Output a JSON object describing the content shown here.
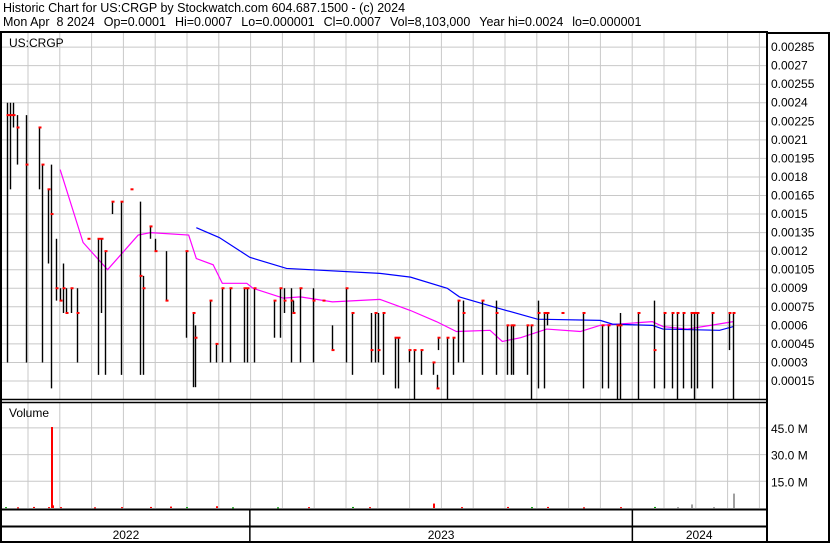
{
  "header": {
    "title": "Historic Chart for US:CRGP by Stockwatch.com 604.687.1500 - (c) 2024",
    "date": "Mon Apr  8 2024",
    "open": "Op=0.0001",
    "high": "Hi=0.0007",
    "low": "Lo=0.000001",
    "close": "Cl=0.0007",
    "volume": "Vol=8,103,000",
    "year_high": "Year hi=0.0024",
    "year_low": "lo=0.000001"
  },
  "colors": {
    "bar": "#000000",
    "close_tick": "#ff0000",
    "ma_short": "#ff00ff",
    "ma_long": "#0000ff",
    "grid": "#c8c8c8",
    "vol_up": "#00a000",
    "vol_down": "#ff0000",
    "vol_flat": "#a0a0a0"
  },
  "chart_data": [
    {
      "type": "ohlc",
      "title": "US:CRGP",
      "x_unit": "trading day index",
      "year_labels": [
        {
          "label": "2022",
          "start_day": 0
        },
        {
          "label": "2023",
          "start_day": 162
        },
        {
          "label": "2024",
          "start_day": 412
        }
      ],
      "ylim": [
        0,
        0.00297
      ],
      "y_ticks": [
        "0.00015",
        "0.0003",
        "0.00045",
        "0.0006",
        "0.00075",
        "0.0009",
        "0.00105",
        "0.0012",
        "0.00135",
        "0.0015",
        "0.00165",
        "0.0018",
        "0.00195",
        "0.0021",
        "0.00225",
        "0.0024",
        "0.00255",
        "0.0027",
        "0.00285"
      ],
      "bars_day_high_low_close": [
        [
          3,
          0.0024,
          0.0003,
          0.0023
        ],
        [
          5,
          0.0024,
          0.0017,
          0.0023
        ],
        [
          7,
          0.0024,
          0.0022,
          0.0023
        ],
        [
          10,
          0.0023,
          0.0019,
          0.0022
        ],
        [
          16,
          0.0023,
          0.0003,
          0.0019
        ],
        [
          24,
          0.0022,
          0.0017,
          0.0022
        ],
        [
          26,
          0.0019,
          0.0003,
          0.0019
        ],
        [
          30,
          0.0017,
          0.0011,
          0.0017
        ],
        [
          32,
          0.0019,
          9e-05,
          0.0015
        ],
        [
          35,
          0.0013,
          0.0008,
          0.0009
        ],
        [
          38,
          0.0009,
          0.0008,
          0.0008
        ],
        [
          40,
          0.0011,
          0.0007,
          0.0009
        ],
        [
          42,
          0.0009,
          0.0007,
          0.0007
        ],
        [
          45,
          0.0009,
          0.0007,
          0.0009
        ],
        [
          49,
          0.0009,
          0.0003,
          0.0007
        ],
        [
          56,
          0.0013,
          0.0013,
          0.0013
        ],
        [
          63,
          0.0013,
          0.0002,
          0.0013
        ],
        [
          65,
          0.0013,
          0.0007,
          0.0013
        ],
        [
          67,
          0.0012,
          0.0002,
          0.0012
        ],
        [
          72,
          0.0016,
          0.0015,
          0.0016
        ],
        [
          78,
          0.0016,
          0.0002,
          0.0016
        ],
        [
          84,
          0.0017,
          0.0017,
          0.0017
        ],
        [
          90,
          0.0016,
          0.0002,
          0.001
        ],
        [
          92,
          0.001,
          0.0002,
          0.0009
        ],
        [
          97,
          0.0014,
          0.0013,
          0.0014
        ],
        [
          100,
          0.0013,
          0.0012,
          0.0012
        ],
        [
          107,
          0.0012,
          0.0008,
          0.0008
        ],
        [
          120,
          0.0012,
          0.0005,
          0.0012
        ],
        [
          125,
          0.0007,
          0.0001,
          0.0007
        ],
        [
          126,
          0.0006,
          0.0001,
          0.0005
        ],
        [
          136,
          0.0008,
          0.0003,
          0.0008
        ],
        [
          140,
          0.00045,
          0.0003,
          0.00045
        ],
        [
          144,
          0.0009,
          0.0003,
          0.0009
        ],
        [
          149,
          0.0009,
          0.0003,
          0.0009
        ],
        [
          158,
          0.0009,
          0.0003,
          0.0009
        ],
        [
          160,
          0.0009,
          0.0003,
          0.0009
        ],
        [
          165,
          0.0009,
          0.0003,
          0.0009
        ],
        [
          178,
          0.0008,
          0.0005,
          0.0008
        ],
        [
          182,
          0.0009,
          0.0005,
          0.0009
        ],
        [
          184,
          0.0009,
          0.0007,
          0.0008
        ],
        [
          189,
          0.0009,
          0.0003,
          0.0008
        ],
        [
          190,
          0.0008,
          0.0007,
          0.0007
        ],
        [
          195,
          0.0009,
          0.0003,
          0.0009
        ],
        [
          203,
          0.0009,
          0.0003,
          0.0008
        ],
        [
          210,
          0.0008,
          0.0008,
          0.0008
        ],
        [
          216,
          0.0006,
          0.0004,
          0.0004
        ],
        [
          225,
          0.0009,
          0.0003,
          0.0009
        ],
        [
          229,
          0.0007,
          0.0002,
          0.0007
        ],
        [
          241,
          0.0007,
          0.0003,
          0.0004
        ],
        [
          244,
          0.0007,
          0.0003,
          0.0007
        ],
        [
          246,
          0.0007,
          0.0003,
          0.0004
        ],
        [
          249,
          0.0007,
          0.0002,
          0.0007
        ],
        [
          257,
          0.0005,
          9e-05,
          0.0005
        ],
        [
          259,
          0.0005,
          9e-05,
          0.0005
        ],
        [
          266,
          0.0004,
          0.0003,
          0.0004
        ],
        [
          269,
          0.0004,
          1e-06,
          0.0004
        ],
        [
          274,
          0.0004,
          0.0002,
          0.0004
        ],
        [
          282,
          0.0003,
          0.0002,
          0.0003
        ],
        [
          284,
          0.0002,
          9e-05,
          9e-05
        ],
        [
          285,
          0.0005,
          0.0004,
          0.0005
        ],
        [
          291,
          0.0005,
          1e-06,
          0.0005
        ],
        [
          295,
          0.0005,
          0.0002,
          0.0005
        ],
        [
          298,
          0.0008,
          0.0003,
          0.0008
        ],
        [
          301,
          0.0008,
          0.0003,
          0.0007
        ],
        [
          314,
          0.0008,
          0.0002,
          0.0008
        ],
        [
          323,
          0.0008,
          0.0002,
          0.0007
        ],
        [
          330,
          0.0006,
          0.0002,
          0.0006
        ],
        [
          333,
          0.0006,
          0.0002,
          0.0006
        ],
        [
          334,
          0.0006,
          0.0002,
          0.0006
        ],
        [
          343,
          0.0006,
          0.0002,
          0.0006
        ],
        [
          346,
          0.0006,
          1e-06,
          0.0006
        ],
        [
          350,
          0.0008,
          9e-05,
          0.0007
        ],
        [
          354,
          0.0007,
          9e-05,
          0.0007
        ],
        [
          356,
          0.0007,
          0.0006,
          0.0007
        ],
        [
          366,
          0.0007,
          0.0007,
          0.0007
        ],
        [
          380,
          0.0007,
          9e-05,
          0.0007
        ],
        [
          392,
          0.0006,
          9e-05,
          0.0006
        ],
        [
          396,
          0.0006,
          9e-05,
          0.0006
        ],
        [
          402,
          0.0006,
          1e-06,
          0.0006
        ],
        [
          404,
          0.0007,
          1e-06,
          0.0006
        ],
        [
          416,
          0.0007,
          1e-06,
          0.0007
        ],
        [
          426,
          0.0008,
          9e-05,
          0.0004
        ],
        [
          433,
          0.0007,
          9e-05,
          0.0007
        ],
        [
          438,
          0.0007,
          9e-05,
          0.0007
        ],
        [
          441,
          0.0007,
          1e-06,
          0.0007
        ],
        [
          445,
          0.0007,
          9e-05,
          0.0007
        ],
        [
          450,
          0.0007,
          9e-05,
          0.0007
        ],
        [
          452,
          0.0007,
          1e-06,
          0.0007
        ],
        [
          454,
          0.0007,
          9e-05,
          0.0007
        ],
        [
          464,
          0.0007,
          9e-05,
          0.0007
        ],
        [
          475,
          0.0007,
          0.0004,
          0.0007
        ],
        [
          478,
          0.0007,
          1e-06,
          0.0007
        ]
      ],
      "series": [
        {
          "name": "short moving average",
          "points_day_value": [
            [
              38,
              0.00186
            ],
            [
              53,
              0.00127
            ],
            [
              69,
              0.00105
            ],
            [
              79,
              0.00119
            ],
            [
              89,
              0.00133
            ],
            [
              97,
              0.00135
            ],
            [
              122,
              0.00133
            ],
            [
              127,
              0.00114
            ],
            [
              138,
              0.00109
            ],
            [
              144,
              0.00094
            ],
            [
              160,
              0.00094
            ],
            [
              164,
              0.0009
            ],
            [
              184,
              0.00082
            ],
            [
              195,
              0.00083
            ],
            [
              216,
              0.00079
            ],
            [
              247,
              0.00081
            ],
            [
              267,
              0.00072
            ],
            [
              284,
              0.00063
            ],
            [
              297,
              0.00055
            ],
            [
              319,
              0.00056
            ],
            [
              327,
              0.00047
            ],
            [
              339,
              0.0005
            ],
            [
              356,
              0.00057
            ],
            [
              378,
              0.00055
            ],
            [
              391,
              0.0006
            ],
            [
              425,
              0.00063
            ],
            [
              432,
              0.00059
            ],
            [
              448,
              0.00057
            ],
            [
              463,
              0.0006
            ],
            [
              478,
              0.00063
            ]
          ]
        },
        {
          "name": "long moving average",
          "points_day_value": [
            [
              127,
              0.00139
            ],
            [
              142,
              0.00131
            ],
            [
              162,
              0.00115
            ],
            [
              186,
              0.00106
            ],
            [
              247,
              0.00102
            ],
            [
              267,
              0.00099
            ],
            [
              291,
              0.0009
            ],
            [
              299,
              0.00083
            ],
            [
              324,
              0.00074
            ],
            [
              350,
              0.00065
            ],
            [
              391,
              0.00064
            ],
            [
              399,
              0.00061
            ],
            [
              425,
              0.0006
            ],
            [
              432,
              0.00057
            ],
            [
              469,
              0.00056
            ],
            [
              478,
              0.00059
            ]
          ]
        }
      ]
    },
    {
      "type": "bar",
      "title": "Volume",
      "unit": "M",
      "ylim": [
        0,
        55
      ],
      "y_ticks": [
        "15.0 M",
        "30.0 M",
        "45.0 M"
      ],
      "bars_day_millions_direction": [
        [
          2,
          0.5,
          "up"
        ],
        [
          10,
          0.4,
          "down"
        ],
        [
          20,
          0.6,
          "down"
        ],
        [
          30,
          0.5,
          "down"
        ],
        [
          32,
          45.5,
          "down"
        ],
        [
          33,
          1.5,
          "down"
        ],
        [
          38,
          0.5,
          "down"
        ],
        [
          60,
          0.4,
          "down"
        ],
        [
          78,
          0.5,
          "down"
        ],
        [
          97,
          0.6,
          "down"
        ],
        [
          110,
          0.8,
          "down"
        ],
        [
          120,
          0.5,
          "up"
        ],
        [
          140,
          1.0,
          "down"
        ],
        [
          150,
          0.4,
          "up"
        ],
        [
          180,
          0.4,
          "up"
        ],
        [
          200,
          0.5,
          "down"
        ],
        [
          229,
          0.6,
          "up"
        ],
        [
          240,
          0.5,
          "down"
        ],
        [
          282,
          2.5,
          "down"
        ],
        [
          300,
          0.5,
          "down"
        ],
        [
          330,
          0.6,
          "down"
        ],
        [
          346,
          0.5,
          "up"
        ],
        [
          356,
          0.6,
          "down"
        ],
        [
          380,
          0.4,
          "down"
        ],
        [
          404,
          0.5,
          "down"
        ],
        [
          426,
          0.6,
          "up"
        ],
        [
          441,
          0.5,
          "flat"
        ],
        [
          450,
          2.0,
          "flat"
        ],
        [
          465,
          0.5,
          "flat"
        ],
        [
          478,
          8.1,
          "flat"
        ]
      ]
    }
  ]
}
